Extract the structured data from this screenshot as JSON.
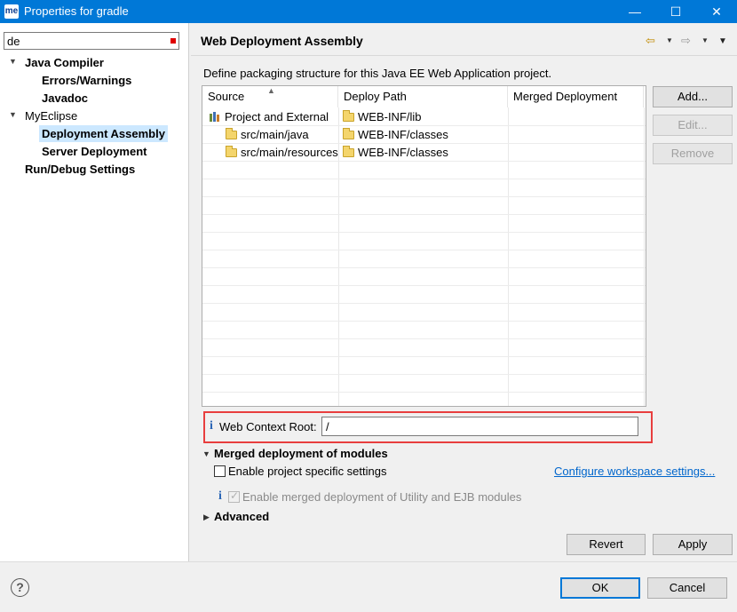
{
  "window": {
    "app_badge": "me",
    "title": "Properties for gradle",
    "minimize": "—",
    "maximize": "☐",
    "close": "✕"
  },
  "sidebar": {
    "filter_value": "de",
    "items": [
      {
        "label": "Java Compiler"
      },
      {
        "label": "Errors/Warnings"
      },
      {
        "label": "Javadoc"
      },
      {
        "label": "MyEclipse"
      },
      {
        "label": "Deployment Assembly"
      },
      {
        "label": "Server Deployment"
      },
      {
        "label": "Run/Debug Settings"
      }
    ]
  },
  "page": {
    "title": "Web Deployment Assembly",
    "description": "Define packaging structure for this Java EE Web Application project."
  },
  "table": {
    "columns": [
      "Source",
      "Deploy Path",
      "Merged Deployment"
    ],
    "rows": [
      {
        "source": "Project and External",
        "deploy_path": "WEB-INF/lib",
        "merged": "",
        "icon": "library-icon"
      },
      {
        "source": "src/main/java",
        "deploy_path": "WEB-INF/classes",
        "merged": "",
        "icon": "folder-icon"
      },
      {
        "source": "src/main/resources",
        "deploy_path": "WEB-INF/classes",
        "merged": "",
        "icon": "folder-icon"
      }
    ]
  },
  "buttons": {
    "add": "Add...",
    "edit": "Edit...",
    "remove": "Remove",
    "revert": "Revert",
    "apply": "Apply",
    "ok": "OK",
    "cancel": "Cancel"
  },
  "context_root": {
    "label": "Web Context Root:",
    "value": "/"
  },
  "merged": {
    "section_title": "Merged deployment of modules",
    "enable_specific": "Enable project specific settings",
    "configure_link": "Configure workspace settings...",
    "enable_merged": "Enable merged deployment of Utility and EJB modules",
    "enable_specific_checked": false,
    "enable_merged_checked": true
  },
  "advanced": {
    "section_title": "Advanced"
  },
  "colors": {
    "titlebar": "#0078d7",
    "selection": "#cce8ff",
    "highlight_border": "#e83e3e",
    "link": "#0066cc"
  }
}
